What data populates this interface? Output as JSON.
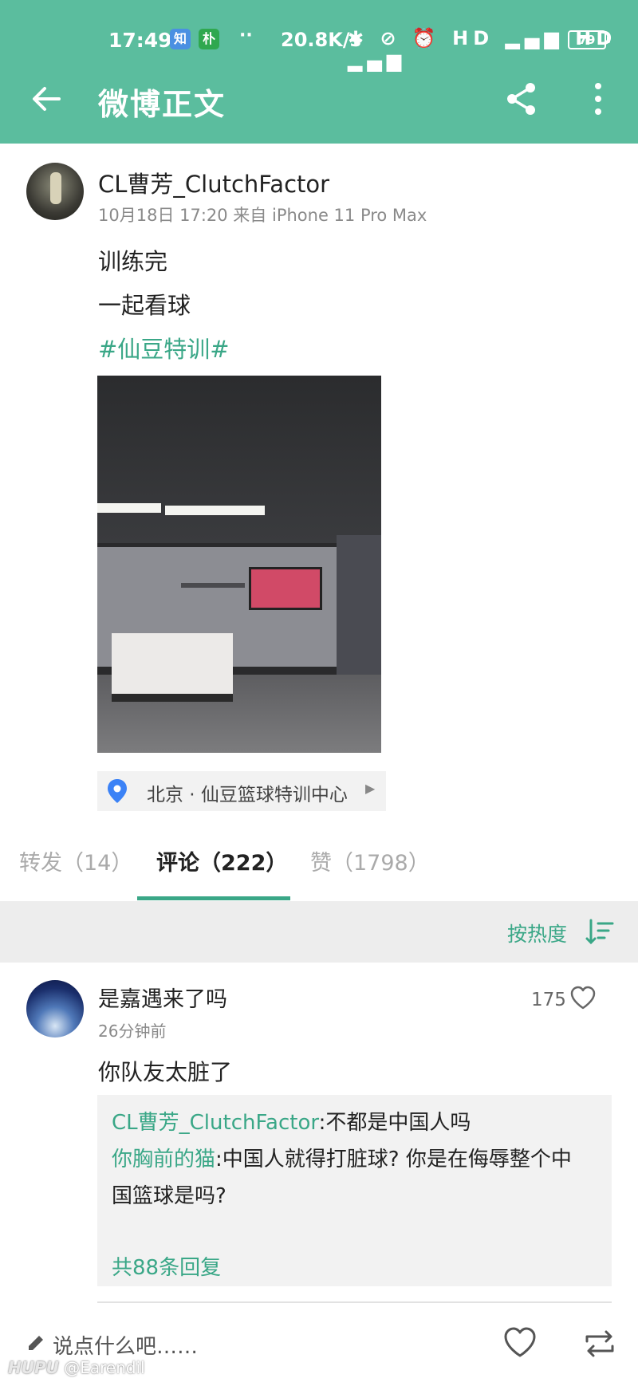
{
  "status_bar": {
    "time": "17:49",
    "chip1": "知",
    "chip2": "朴",
    "dots": "··",
    "speed": "20.8K/s",
    "icons": "✱ ⊘ ⏰ HD ▂▄▆ HD ▂▄▆",
    "battery": "79"
  },
  "header": {
    "title": "微博正文",
    "icons": [
      "back-arrow-icon",
      "share-icon",
      "more-vertical-icon"
    ]
  },
  "post": {
    "username": "CL曹芳_ClutchFactor",
    "meta": "10月18日 17:20  来自 iPhone 11 Pro Max",
    "lines": [
      "训练完",
      "一起看球"
    ],
    "hashtag": "#仙豆特训#",
    "location": "北京 · 仙豆篮球特训中心"
  },
  "tabs": [
    {
      "label": "转发（14）"
    },
    {
      "label": "评论（222）"
    },
    {
      "label": "赞（1798）"
    }
  ],
  "sort": {
    "label": "按热度"
  },
  "comment": {
    "name": "是嘉遇来了吗",
    "time": "26分钟前",
    "likes": "175",
    "text": "你队友太脏了",
    "replies": [
      {
        "who": "CL曹芳_ClutchFactor",
        "text": ":不都是中国人吗"
      },
      {
        "who": "你胸前的猫",
        "text": ":中国人就得打脏球? 你是在侮辱整个中国篮球是吗?"
      }
    ],
    "more": "共88条回复"
  },
  "input": {
    "placeholder": "说点什么吧……"
  },
  "watermark": {
    "brand": "HUPU",
    "handle": "@Earendil"
  },
  "colors": {
    "header": "#5bbd9e",
    "accent": "#3aa787"
  }
}
